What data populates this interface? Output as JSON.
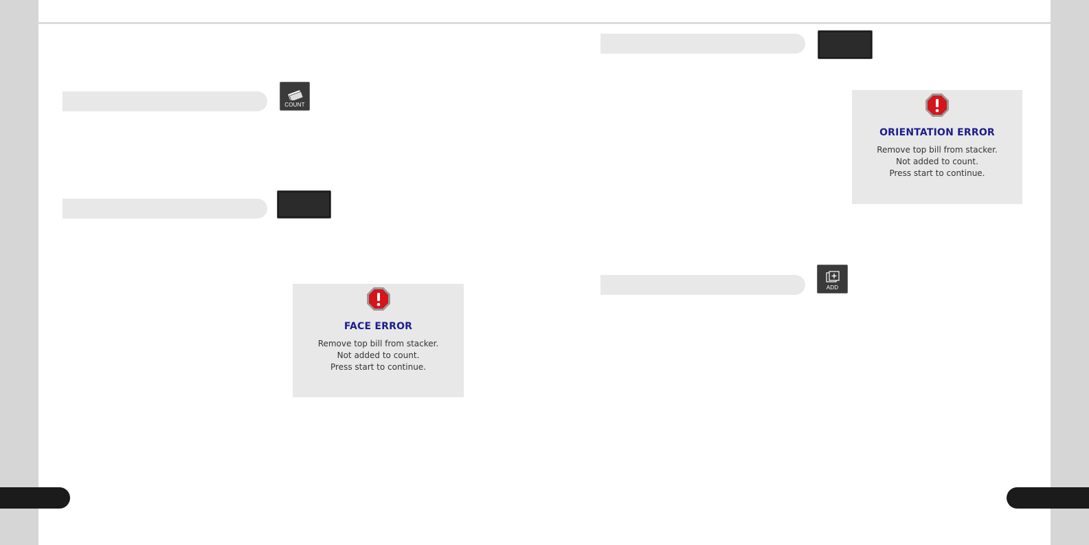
{
  "buttons": {
    "count": {
      "label": "COUNT",
      "icon": "bills-icon"
    },
    "add": {
      "label": "ADD",
      "icon": "add-plus-icon"
    }
  },
  "alerts": {
    "face": {
      "icon": "stop-exclamation-icon",
      "title": "FACE ERROR",
      "lines": [
        "Remove top bill from stacker.",
        "Not added to count.",
        "Press start to continue."
      ]
    },
    "orientation": {
      "icon": "stop-exclamation-icon",
      "title": "ORIENTATION ERROR",
      "lines": [
        "Remove top bill from stacker.",
        "Not added to count.",
        "Press start to continue."
      ]
    }
  },
  "colors": {
    "alert_title": "#1c1d8c",
    "stop_red": "#d4151b",
    "panel_gray": "#e8e8e8",
    "button_dark": "#2b2b2b"
  }
}
